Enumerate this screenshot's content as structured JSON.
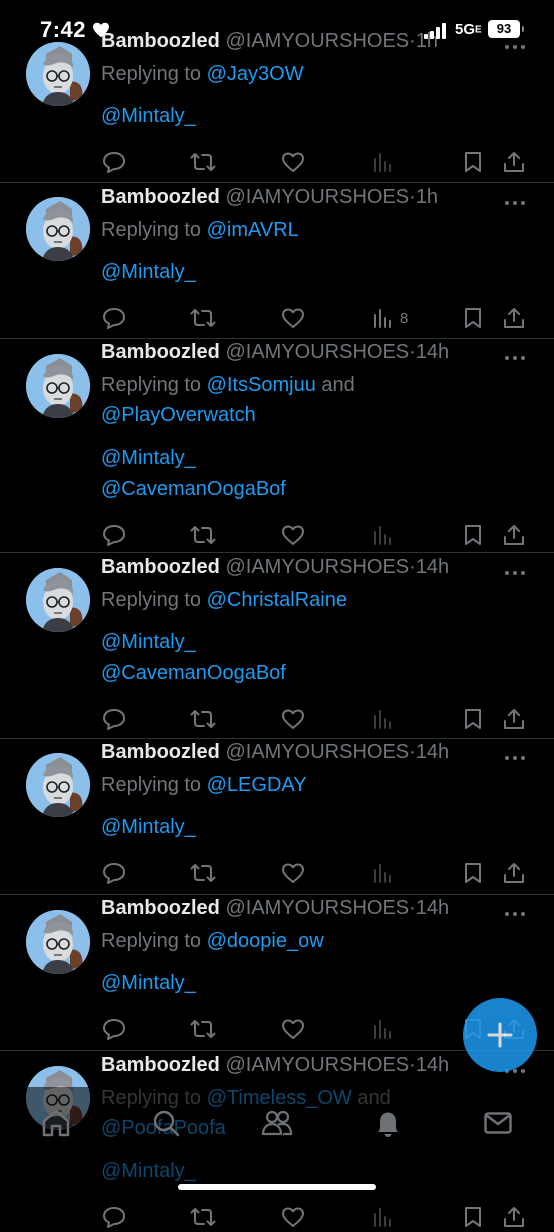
{
  "status_bar": {
    "time": "7:42",
    "network": "5G",
    "network_suffix": "E",
    "battery": "93"
  },
  "colors": {
    "accent": "#1d9bf0",
    "muted": "#71767b",
    "text": "#e7e9ea",
    "background": "#000000"
  },
  "tweets": [
    {
      "name": "Bamboozled",
      "handle": "@IAMYOURSHOES",
      "dot": "·",
      "time": "1h",
      "replying_prefix": "Replying to ",
      "replying_to": "@Jay3OW",
      "replying_and": "",
      "replying_second": "",
      "body_line_1": "@Mintaly_",
      "body_line_2": "",
      "views": ""
    },
    {
      "name": "Bamboozled",
      "handle": "@IAMYOURSHOES",
      "dot": "·",
      "time": "1h",
      "replying_prefix": "Replying to ",
      "replying_to": "@imAVRL",
      "replying_and": "",
      "replying_second": "",
      "body_line_1": "@Mintaly_",
      "body_line_2": "",
      "views": "8"
    },
    {
      "name": "Bamboozled",
      "handle": "@IAMYOURSHOES",
      "dot": "·",
      "time": "14h",
      "replying_prefix": "Replying to ",
      "replying_to": "@ItsSomjuu",
      "replying_and": " and ",
      "replying_second": "@PlayOverwatch",
      "body_line_1": "@Mintaly_",
      "body_line_2": "@CavemanOogaBof",
      "views": ""
    },
    {
      "name": "Bamboozled",
      "handle": "@IAMYOURSHOES",
      "dot": "·",
      "time": "14h",
      "replying_prefix": "Replying to ",
      "replying_to": "@ChristalRaine",
      "replying_and": "",
      "replying_second": "",
      "body_line_1": "@Mintaly_",
      "body_line_2": "@CavemanOogaBof",
      "views": ""
    },
    {
      "name": "Bamboozled",
      "handle": "@IAMYOURSHOES",
      "dot": "·",
      "time": "14h",
      "replying_prefix": "Replying to ",
      "replying_to": "@LEGDAY",
      "replying_and": "",
      "replying_second": "",
      "body_line_1": "@Mintaly_",
      "body_line_2": "",
      "views": ""
    },
    {
      "name": "Bamboozled",
      "handle": "@IAMYOURSHOES",
      "dot": "·",
      "time": "14h",
      "replying_prefix": "Replying to ",
      "replying_to": "@doopie_ow",
      "replying_and": "",
      "replying_second": "",
      "body_line_1": "@Mintaly_",
      "body_line_2": "",
      "views": ""
    },
    {
      "name": "Bamboozled",
      "handle": "@IAMYOURSHOES",
      "dot": "·",
      "time": "14h",
      "replying_prefix": "Replying to ",
      "replying_to": "@Timeless_OW",
      "replying_and": " and ",
      "replying_second": "@PoofaPoofa",
      "body_line_1": "@Mintaly_",
      "body_line_2": "",
      "views": ""
    }
  ],
  "bottom_nav": [
    "home-icon",
    "search-icon",
    "communities-icon",
    "notifications-icon",
    "messages-icon"
  ],
  "fab_icon": "compose-plus-icon"
}
